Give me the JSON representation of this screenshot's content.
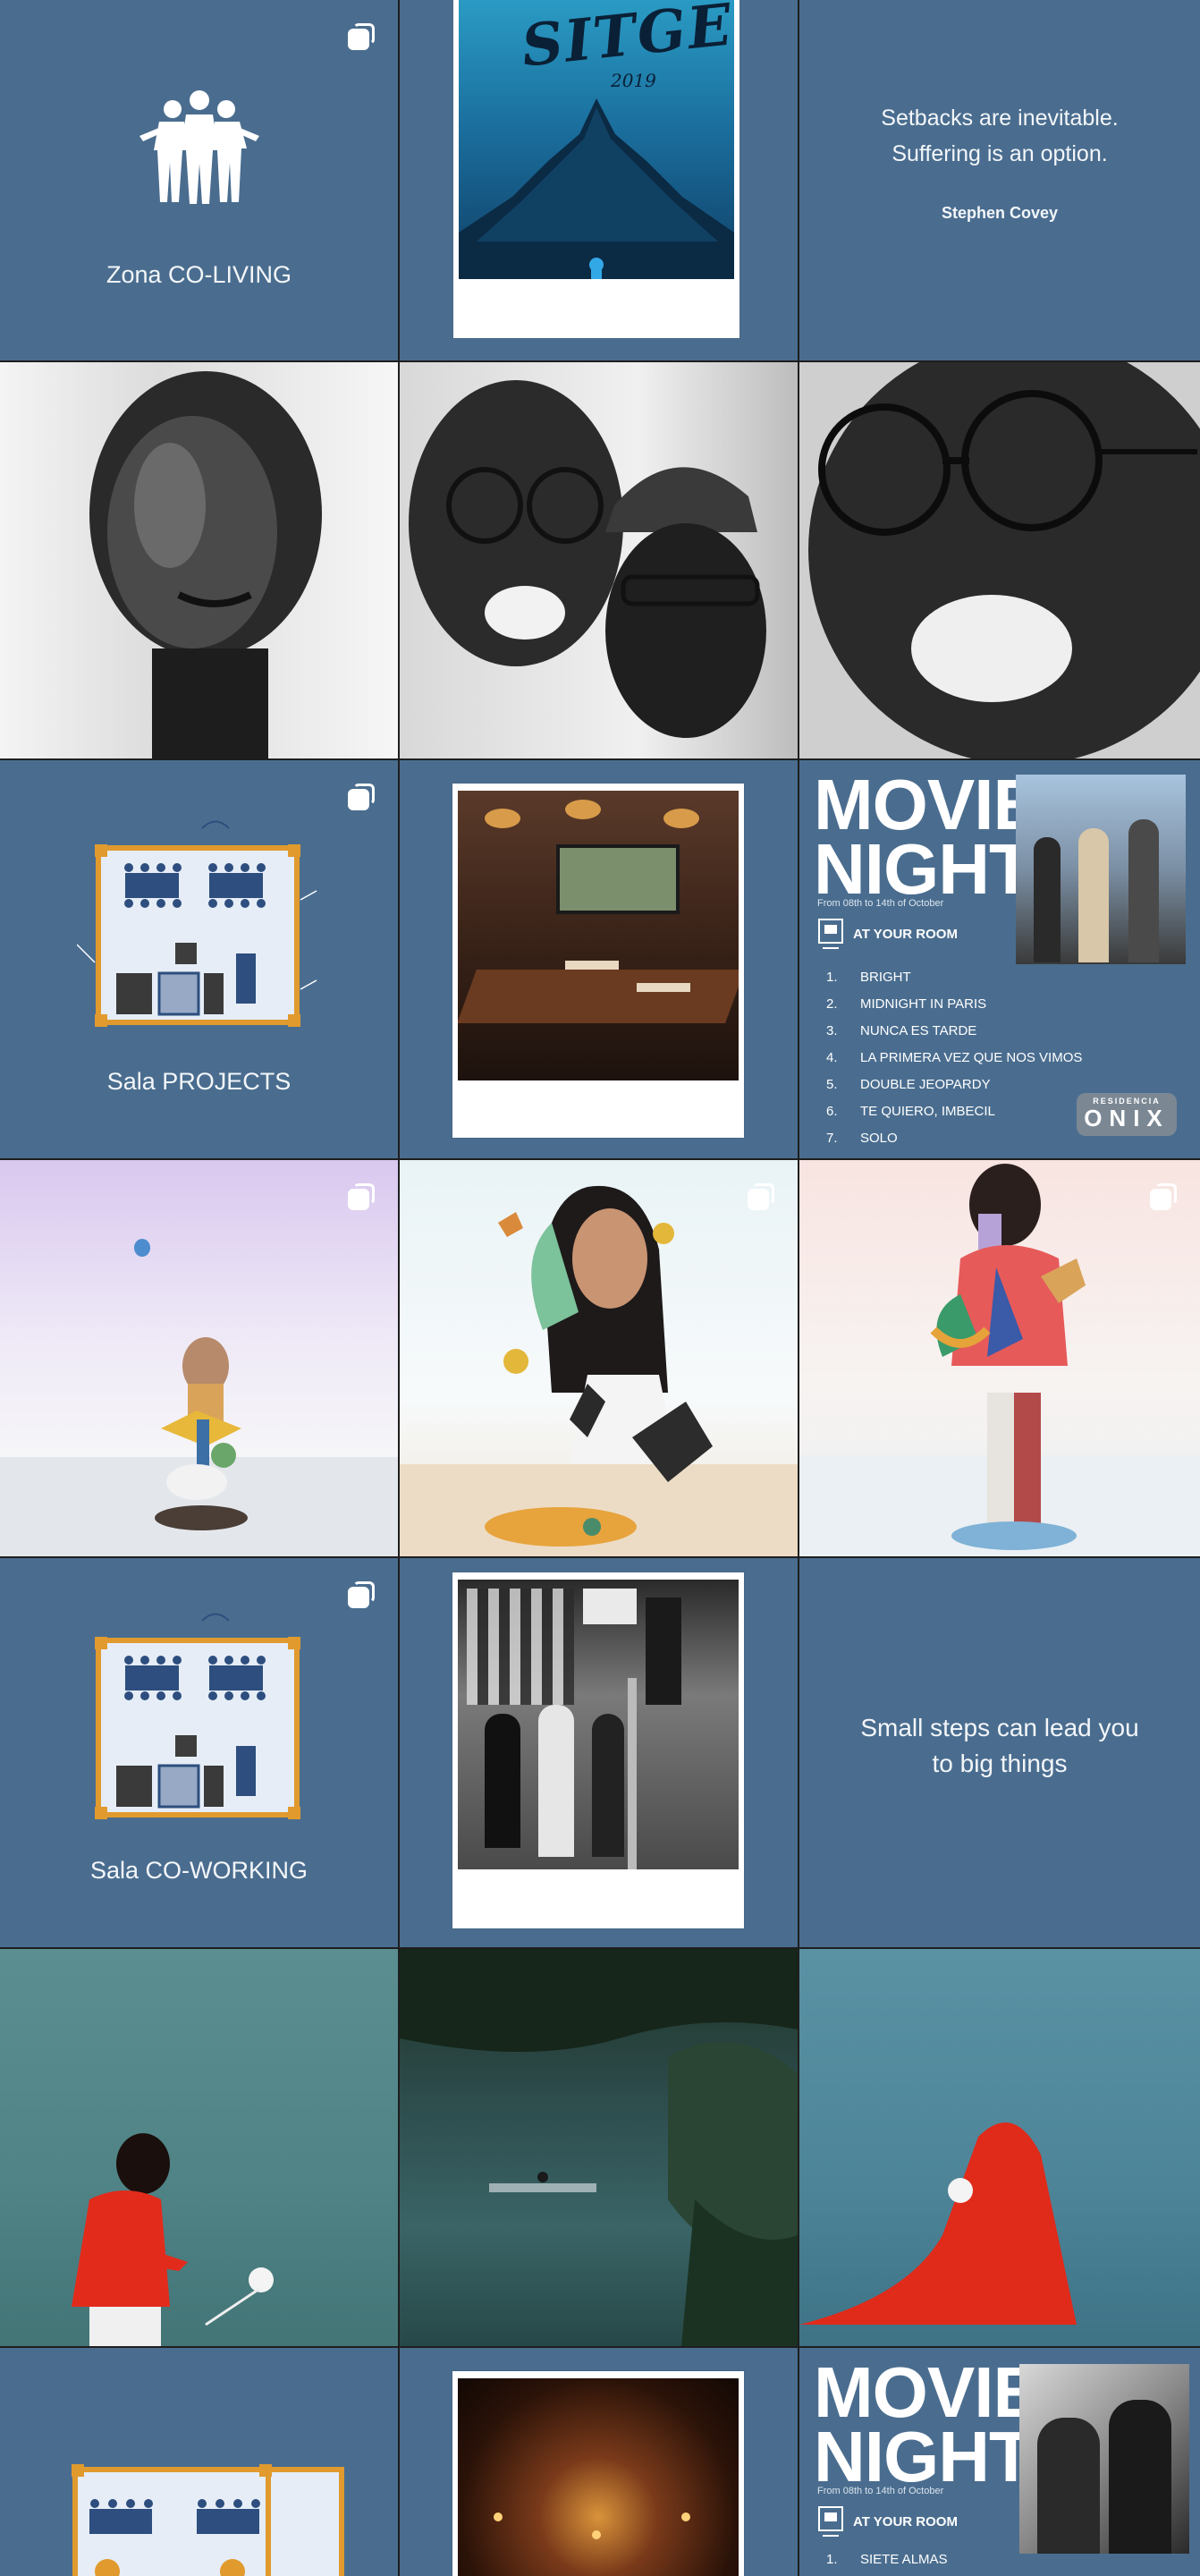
{
  "tiles": {
    "coliving_label": "Zona CO-LIVING",
    "quote1_text": "Setbacks are inevitable.",
    "quote1_text2": "Suffering is an option.",
    "quote1_author": "Stephen Covey",
    "sitges_title": "SITGES",
    "sitges_year": "2019",
    "projects_label": "Sala PROJECTS",
    "coworking_label": "Sala CO-WORKING",
    "quote2_line1": "Small steps can lead you",
    "quote2_line2": "to big things"
  },
  "movie_night_1": {
    "title_line1": "MOVIE",
    "title_line2": "NIGHT",
    "dates": "From 08th to 14th of October",
    "location": "AT YOUR ROOM",
    "badge_small": "RESIDENCIA",
    "badge_big": "ONIX",
    "films": [
      {
        "num": "1.",
        "title": "BRIGHT"
      },
      {
        "num": "2.",
        "title": "MIDNIGHT IN PARIS"
      },
      {
        "num": "3.",
        "title": "NUNCA ES TARDE"
      },
      {
        "num": "4.",
        "title": "LA PRIMERA VEZ QUE NOS VIMOS"
      },
      {
        "num": "5.",
        "title": "DOUBLE JEOPARDY"
      },
      {
        "num": "6.",
        "title": "TE QUIERO, IMBECIL"
      },
      {
        "num": "7.",
        "title": "SOLO"
      }
    ]
  },
  "movie_night_2": {
    "title_line1": "MOVIE",
    "title_line2": "NIGHT",
    "dates": "From 08th to 14th of October",
    "location": "AT YOUR ROOM",
    "films": [
      {
        "num": "1.",
        "title": "SIETE ALMAS"
      }
    ]
  },
  "colors": {
    "tile_blue": "#4a6d8f",
    "divider": "#1e1e1e",
    "text_light": "#f3f6f9"
  },
  "icons": [
    "people-group-icon",
    "multiple-images-icon",
    "floor-plan-icon",
    "projector-icon"
  ]
}
